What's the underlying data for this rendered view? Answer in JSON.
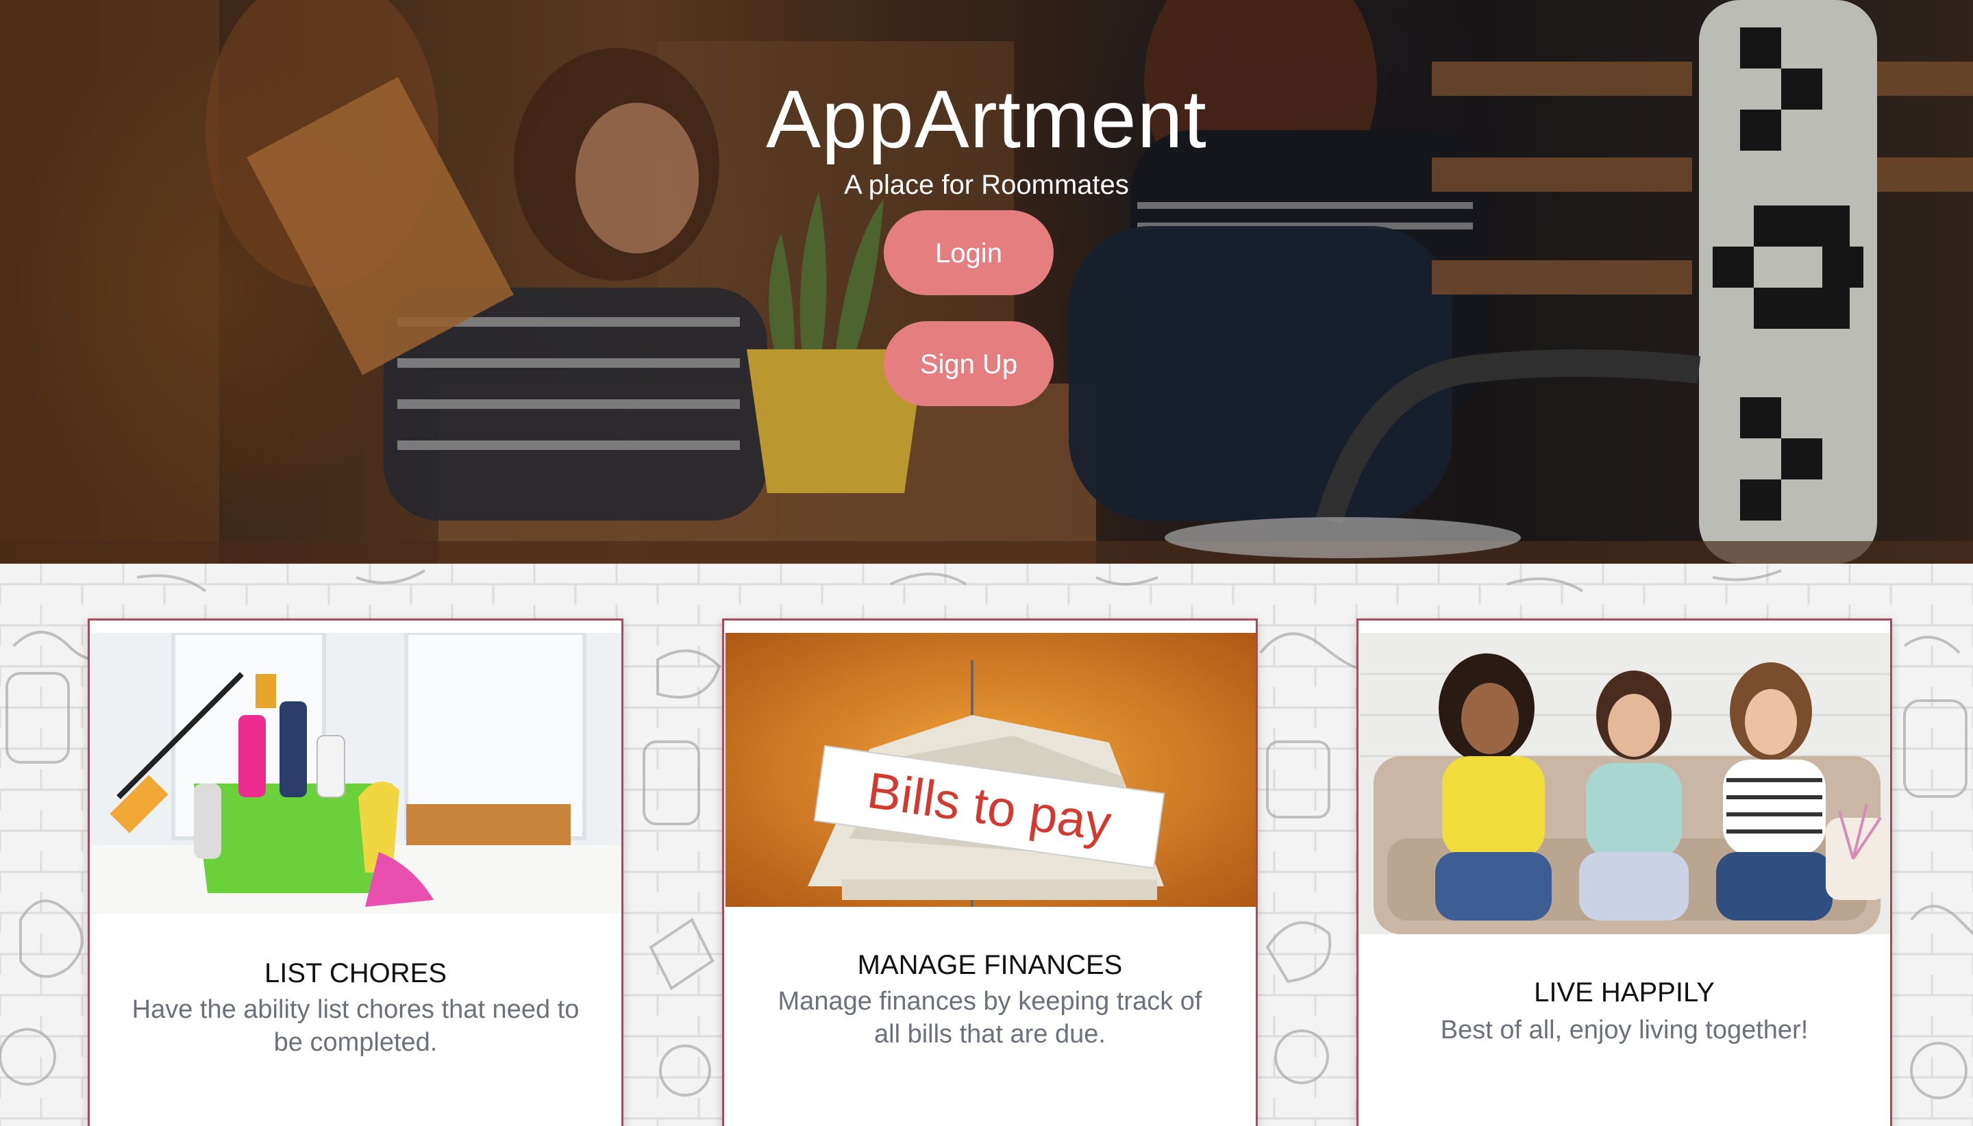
{
  "hero": {
    "title": "AppArtment",
    "subtitle": "A place for Roommates",
    "login_label": "Login",
    "signup_label": "Sign Up"
  },
  "features": [
    {
      "title": "LIST CHORES",
      "text": "Have the ability list chores that need to be completed.",
      "image": "cleaning-supplies-bucket"
    },
    {
      "title": "MANAGE FINANCES",
      "text": "Manage finances by keeping track of all bills that are due.",
      "image": "bills-to-pay-spike",
      "image_label": "Bills to pay"
    },
    {
      "title": "LIVE HAPPILY",
      "text": "Best of all, enjoy living together!",
      "image": "roommates-on-sofa"
    }
  ],
  "colors": {
    "accent": "#e57f7f",
    "card_border": "#a94a5b",
    "muted_text": "#6b717b"
  }
}
